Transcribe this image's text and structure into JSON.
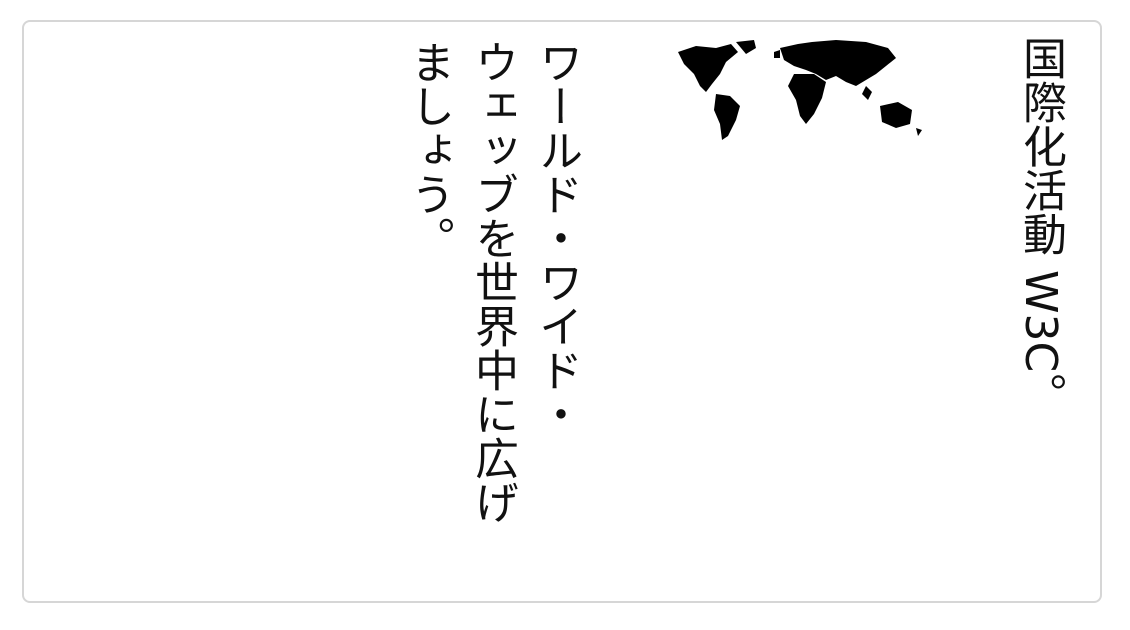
{
  "heading": "国際化活動 W3C。",
  "paragraph": {
    "lines": [
      "ワールド・ワイド・",
      "ウェッブを世界中に広げ",
      "ましょう。"
    ]
  },
  "image": {
    "icon": "world-map-icon"
  },
  "colors": {
    "border": "#d6d6d6",
    "text": "#111111"
  }
}
